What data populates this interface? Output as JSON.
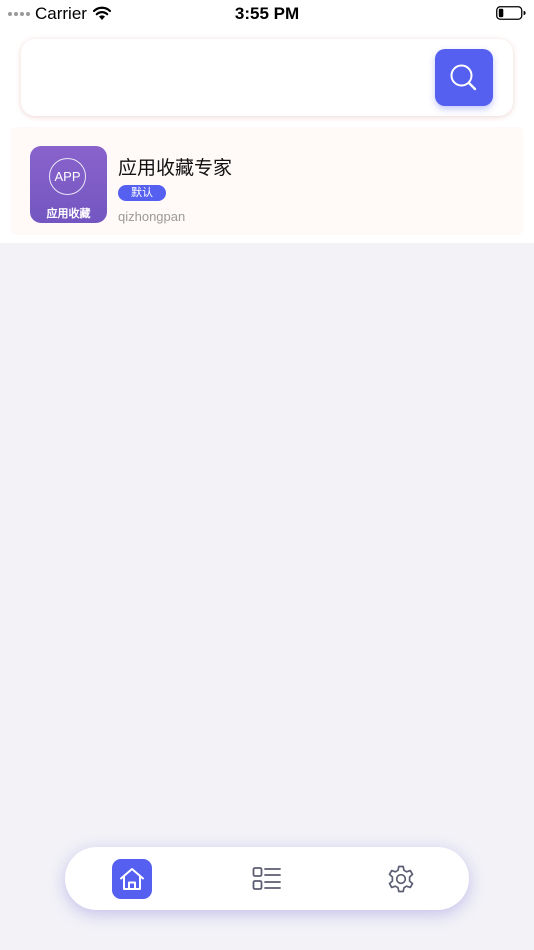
{
  "status_bar": {
    "carrier": "Carrier",
    "time": "3:55 PM"
  },
  "search": {
    "placeholder": "",
    "value": "",
    "button_icon": "search-icon"
  },
  "apps": [
    {
      "icon_text": "APP",
      "icon_label": "应用收藏",
      "name": "应用收藏专家",
      "badge": "默认",
      "author": "qizhongpan"
    }
  ],
  "tab_bar": {
    "items": [
      {
        "icon": "home-icon",
        "active": true
      },
      {
        "icon": "list-icon",
        "active": false
      },
      {
        "icon": "gear-icon",
        "active": false
      }
    ]
  },
  "colors": {
    "accent": "#5560f0",
    "app_icon": "#7d5cc6",
    "background": "#f2f2f7"
  }
}
